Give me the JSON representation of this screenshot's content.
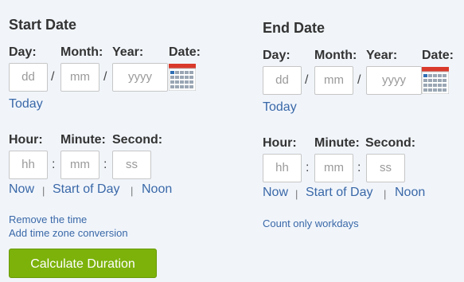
{
  "start": {
    "heading": "Start Date",
    "labels": {
      "day": "Day:",
      "month": "Month:",
      "year": "Year:",
      "date": "Date:",
      "hour": "Hour:",
      "minute": "Minute:",
      "second": "Second:"
    },
    "placeholders": {
      "day": "dd",
      "month": "mm",
      "year": "yyyy",
      "hour": "hh",
      "minute": "mm",
      "second": "ss"
    },
    "today_link": "Today",
    "time_links": {
      "now": "Now",
      "start_of_day": "Start of Day",
      "noon": "Noon"
    },
    "extra_links": {
      "remove_time": "Remove the time",
      "timezone": "Add time zone conversion"
    }
  },
  "end": {
    "heading": "End Date",
    "labels": {
      "day": "Day:",
      "month": "Month:",
      "year": "Year:",
      "date": "Date:",
      "hour": "Hour:",
      "minute": "Minute:",
      "second": "Second:"
    },
    "placeholders": {
      "day": "dd",
      "month": "mm",
      "year": "yyyy",
      "hour": "hh",
      "minute": "mm",
      "second": "ss"
    },
    "today_link": "Today",
    "time_links": {
      "now": "Now",
      "start_of_day": "Start of Day",
      "noon": "Noon"
    },
    "extra_links": {
      "workdays": "Count only workdays"
    }
  },
  "separators": {
    "date": "/",
    "time": ":",
    "pipe": "|"
  },
  "button": {
    "label": "Calculate Duration"
  },
  "icons": {
    "calendar": "calendar-icon"
  },
  "colors": {
    "link": "#3a68a8",
    "button": "#7cb20a",
    "background": "#f1f5fa",
    "calendar_top": "#d93a2b"
  }
}
